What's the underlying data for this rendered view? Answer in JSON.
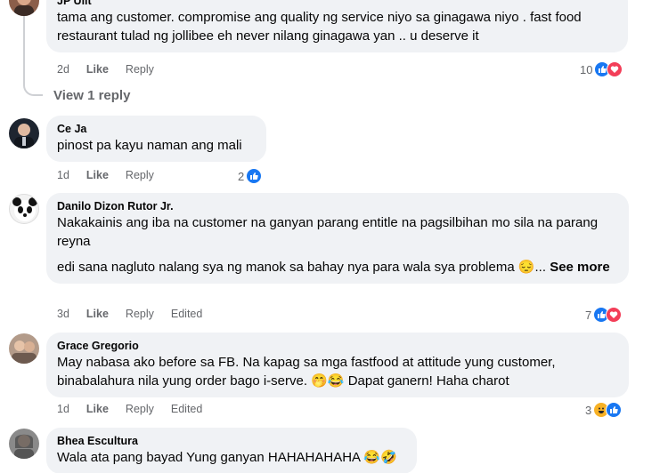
{
  "comments": [
    {
      "author": "JP Ulit",
      "lines": [
        "tama ang customer. compromise ang quality ng service niyo sa ginagawa niyo . fast food restaurant tulad ng jollibee eh never nilang ginagawa yan .. u deserve it"
      ],
      "time": "2d",
      "like": "Like",
      "reply": "Reply",
      "reaction_count": "10",
      "reactions": [
        "like-icon",
        "heart-icon"
      ]
    },
    {
      "author": "Ce Ja",
      "lines": [
        "pinost pa kayu naman ang mali"
      ],
      "time": "1d",
      "like": "Like",
      "reply": "Reply",
      "reaction_count": "2",
      "reactions": [
        "like-icon"
      ]
    },
    {
      "author": "Danilo Dizon Rutor Jr.",
      "lines": [
        "Nakakainis ang iba na customer na ganyan parang entitle na pagsilbihan mo sila na parang reyna",
        "edi sana nagluto nalang sya ng manok sa bahay nya para wala sya problema 😔..."
      ],
      "see_more": "See more",
      "time": "3d",
      "like": "Like",
      "reply": "Reply",
      "edited": "Edited",
      "reaction_count": "7",
      "reactions": [
        "like-icon",
        "heart-icon"
      ]
    },
    {
      "author": "Grace Gregorio",
      "lines": [
        "May nabasa ako before sa FB. Na kapag sa mga fastfood at attitude yung customer, binabalahura nila yung order bago i-serve. 🤭😂 Dapat ganern! Haha charot"
      ],
      "time": "1d",
      "like": "Like",
      "reply": "Reply",
      "edited": "Edited",
      "reaction_count": "3",
      "reactions": [
        "haha-icon",
        "like-icon"
      ]
    },
    {
      "author": "Bhea Escultura",
      "lines": [
        "Wala ata pang bayad Yung ganyan HAHAHAHAHA 😂🤣"
      ]
    }
  ],
  "view_replies": "View 1 reply",
  "colors": {
    "like": "#1877f2",
    "heart": "#f33e58",
    "haha": "#f7b125",
    "bubble": "#f0f2f5",
    "meta": "#65676b"
  }
}
